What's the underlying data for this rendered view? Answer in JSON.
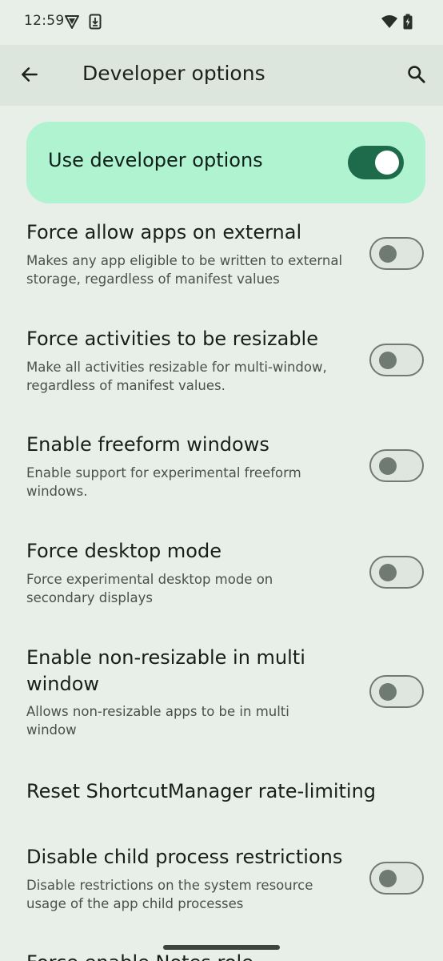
{
  "status_bar": {
    "time": "12:59",
    "left_icons": [
      "vpn-shield-icon",
      "download-notification-icon"
    ],
    "right_icons": [
      "wifi-icon",
      "battery-icon"
    ]
  },
  "app_bar": {
    "title": "Developer options",
    "back_icon": "arrow-back-icon",
    "search_icon": "search-icon"
  },
  "master_switch": {
    "label": "Use developer options",
    "checked": true
  },
  "settings": [
    {
      "title": "Force allow apps on external",
      "summary": "Makes any app eligible to be written to external storage, regardless of manifest values",
      "checked": false
    },
    {
      "title": "Force activities to be resizable",
      "summary": "Make all activities resizable for multi-window, regardless of manifest values.",
      "checked": false
    },
    {
      "title": "Enable freeform windows",
      "summary": "Enable support for experimental freeform windows.",
      "checked": false
    },
    {
      "title": "Force desktop mode",
      "summary": "Force experimental desktop mode on secondary displays",
      "checked": false
    },
    {
      "title": "Enable non-resizable in multi window",
      "summary": "Allows non-resizable apps to be in multi window",
      "checked": false
    },
    {
      "title": "Reset ShortcutManager rate-limiting"
    },
    {
      "title": "Disable child process restrictions",
      "summary": "Disable restrictions on the system resource usage of the app child processes",
      "checked": false
    },
    {
      "title": "Force enable Notes role"
    }
  ],
  "colors": {
    "background": "#e8efe9",
    "app_bar": "#dce6dd",
    "master_card": "#b0f3d1",
    "toggle_on_track": "#1d6b4a",
    "toggle_off_outline": "#6f7a72"
  }
}
